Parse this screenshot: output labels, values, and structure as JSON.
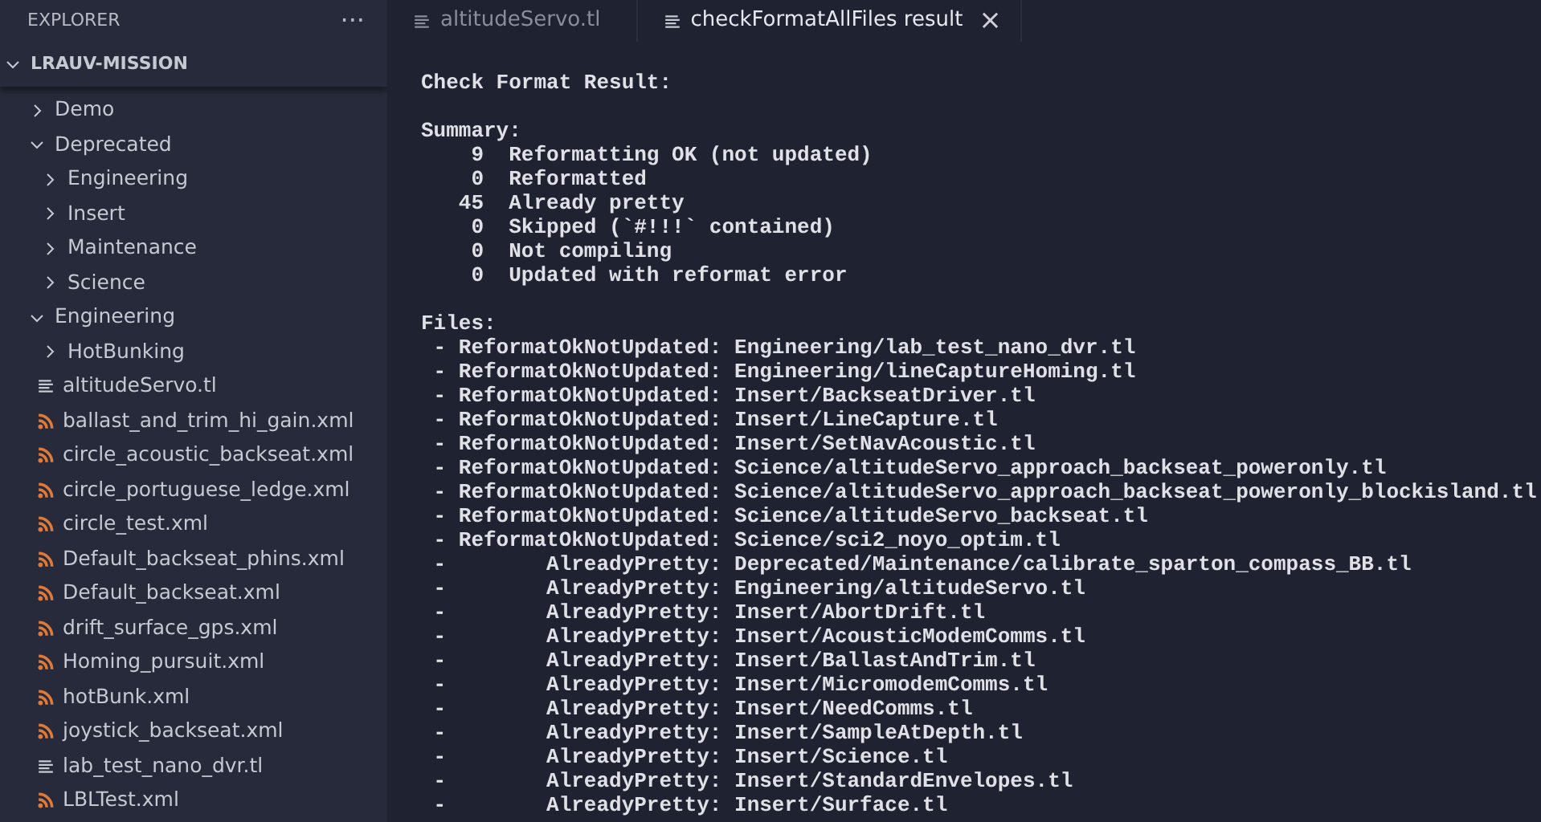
{
  "sidebar": {
    "title": "EXPLORER",
    "more": "···",
    "root": {
      "label": "LRAUV-MISSION",
      "expanded": true
    },
    "tree": [
      {
        "label": "Demo",
        "kind": "folder",
        "expanded": false
      },
      {
        "label": "Deprecated",
        "kind": "folder",
        "expanded": true,
        "children": [
          {
            "label": "Engineering",
            "kind": "folder",
            "expanded": false
          },
          {
            "label": "Insert",
            "kind": "folder",
            "expanded": false
          },
          {
            "label": "Maintenance",
            "kind": "folder",
            "expanded": false
          },
          {
            "label": "Science",
            "kind": "folder",
            "expanded": false
          }
        ]
      },
      {
        "label": "Engineering",
        "kind": "folder",
        "expanded": true,
        "children": [
          {
            "label": "HotBunking",
            "kind": "folder",
            "expanded": false
          },
          {
            "label": "altitudeServo.tl",
            "kind": "tl"
          },
          {
            "label": "ballast_and_trim_hi_gain.xml",
            "kind": "xml"
          },
          {
            "label": "circle_acoustic_backseat.xml",
            "kind": "xml"
          },
          {
            "label": "circle_portuguese_ledge.xml",
            "kind": "xml"
          },
          {
            "label": "circle_test.xml",
            "kind": "xml"
          },
          {
            "label": "Default_backseat_phins.xml",
            "kind": "xml"
          },
          {
            "label": "Default_backseat.xml",
            "kind": "xml"
          },
          {
            "label": "drift_surface_gps.xml",
            "kind": "xml"
          },
          {
            "label": "Homing_pursuit.xml",
            "kind": "xml"
          },
          {
            "label": "hotBunk.xml",
            "kind": "xml"
          },
          {
            "label": "joystick_backseat.xml",
            "kind": "xml"
          },
          {
            "label": "lab_test_nano_dvr.tl",
            "kind": "tl"
          },
          {
            "label": "LBLTest.xml",
            "kind": "xml"
          }
        ]
      }
    ]
  },
  "tabs": [
    {
      "label": "altitudeServo.tl",
      "selected": false
    },
    {
      "label": "checkFormatAllFiles result",
      "selected": true,
      "close": "×"
    }
  ],
  "output": {
    "title": "Check Format Result:",
    "summary": {
      "heading": "Summary:",
      "items": [
        {
          "count": "9",
          "label": "Reformatting OK (not updated)"
        },
        {
          "count": "0",
          "label": "Reformatted"
        },
        {
          "count": "45",
          "label": "Already pretty"
        },
        {
          "count": "0",
          "label": "Skipped (`#!!!` contained)"
        },
        {
          "count": "0",
          "label": "Not compiling"
        },
        {
          "count": "0",
          "label": "Updated with reformat error"
        }
      ]
    },
    "files": {
      "heading": "Files:",
      "entries": [
        {
          "marker": "-",
          "status": "ReformatOkNotUpdated:",
          "path": "Engineering/lab_test_nano_dvr.tl"
        },
        {
          "marker": "-",
          "status": "ReformatOkNotUpdated:",
          "path": "Engineering/lineCaptureHoming.tl"
        },
        {
          "marker": "-",
          "status": "ReformatOkNotUpdated:",
          "path": "Insert/BackseatDriver.tl"
        },
        {
          "marker": "-",
          "status": "ReformatOkNotUpdated:",
          "path": "Insert/LineCapture.tl"
        },
        {
          "marker": "-",
          "status": "ReformatOkNotUpdated:",
          "path": "Insert/SetNavAcoustic.tl"
        },
        {
          "marker": "-",
          "status": "ReformatOkNotUpdated:",
          "path": "Science/altitudeServo_approach_backseat_poweronly.tl"
        },
        {
          "marker": "-",
          "status": "ReformatOkNotUpdated:",
          "path": "Science/altitudeServo_approach_backseat_poweronly_blockisland.tl"
        },
        {
          "marker": "-",
          "status": "ReformatOkNotUpdated:",
          "path": "Science/altitudeServo_backseat.tl"
        },
        {
          "marker": "-",
          "status": "ReformatOkNotUpdated:",
          "path": "Science/sci2_noyo_optim.tl"
        },
        {
          "marker": "-",
          "status": "AlreadyPretty:",
          "path": "Deprecated/Maintenance/calibrate_sparton_compass_BB.tl"
        },
        {
          "marker": "-",
          "status": "AlreadyPretty:",
          "path": "Engineering/altitudeServo.tl"
        },
        {
          "marker": "-",
          "status": "AlreadyPretty:",
          "path": "Insert/AbortDrift.tl"
        },
        {
          "marker": "-",
          "status": "AlreadyPretty:",
          "path": "Insert/AcousticModemComms.tl"
        },
        {
          "marker": "-",
          "status": "AlreadyPretty:",
          "path": "Insert/BallastAndTrim.tl"
        },
        {
          "marker": "-",
          "status": "AlreadyPretty:",
          "path": "Insert/MicromodemComms.tl"
        },
        {
          "marker": "-",
          "status": "AlreadyPretty:",
          "path": "Insert/NeedComms.tl"
        },
        {
          "marker": "-",
          "status": "AlreadyPretty:",
          "path": "Insert/SampleAtDepth.tl"
        },
        {
          "marker": "-",
          "status": "AlreadyPretty:",
          "path": "Insert/Science.tl"
        },
        {
          "marker": "-",
          "status": "AlreadyPretty:",
          "path": "Insert/StandardEnvelopes.tl"
        },
        {
          "marker": "-",
          "status": "AlreadyPretty:",
          "path": "Insert/Surface.tl"
        }
      ]
    }
  }
}
